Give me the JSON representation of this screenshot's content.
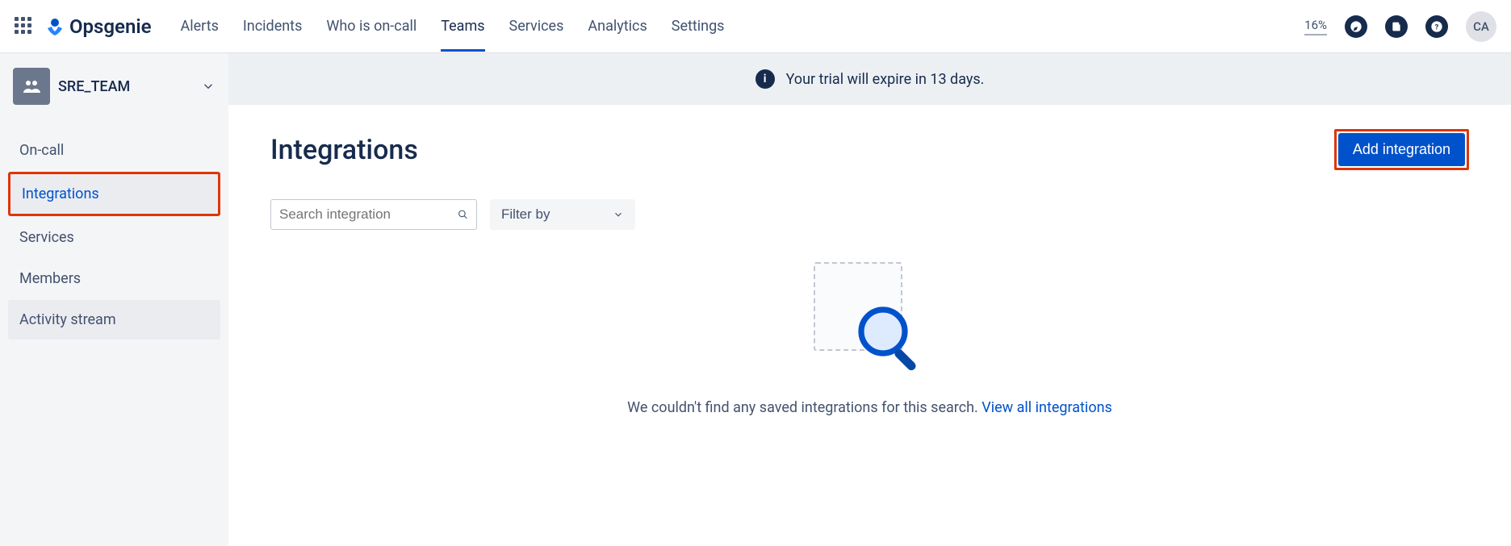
{
  "brand": "Opsgenie",
  "nav": {
    "alerts": "Alerts",
    "incidents": "Incidents",
    "oncall": "Who is on-call",
    "teams": "Teams",
    "services": "Services",
    "analytics": "Analytics",
    "settings": "Settings"
  },
  "progress_percent": "16%",
  "avatar_initials": "CA",
  "team": {
    "name": "SRE_TEAM"
  },
  "sidebar": {
    "oncall": "On-call",
    "integrations": "Integrations",
    "services": "Services",
    "members": "Members",
    "activity": "Activity stream"
  },
  "banner": {
    "text": "Your trial will expire in 13 days."
  },
  "page": {
    "title": "Integrations",
    "add_button": "Add integration",
    "search_placeholder": "Search integration",
    "filter_label": "Filter by",
    "empty_text": "We couldn't find any saved integrations for this search. ",
    "view_all_link": "View all integrations"
  }
}
